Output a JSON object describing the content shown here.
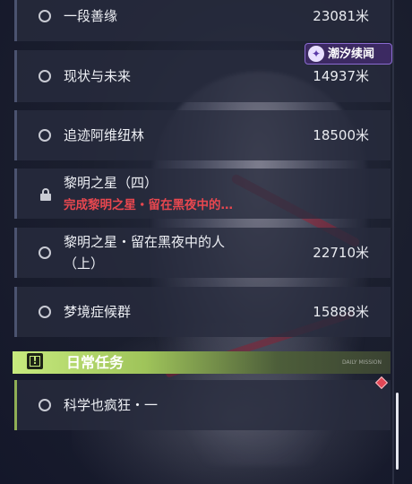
{
  "quests": [
    {
      "title": "一段善缘",
      "distance": "23081米"
    },
    {
      "title": "现状与未来",
      "distance": "14937米"
    },
    {
      "title": "追迹阿维纽林",
      "distance": "18500米"
    },
    {
      "title": "黎明之星（四）",
      "subtitle": "完成黎明之星・留在黑夜中的…",
      "locked": true
    },
    {
      "title_line1": "黎明之星・留在黑夜中的人",
      "title_line2": "（上）",
      "distance": "22710米"
    },
    {
      "title": "梦境症候群",
      "distance": "15888米"
    }
  ],
  "brand_badge": {
    "text": "潮汐续闻",
    "icon": "tide-logo-icon"
  },
  "daily_section": {
    "title": "日常任务",
    "icon": "exclamation-icon",
    "tag": "DAILY MISSION"
  },
  "daily_quests": [
    {
      "title": "科学也疯狂・一"
    }
  ],
  "colors": {
    "accent_green": "#c7ea7e",
    "alert_red": "#e8474f",
    "badge_purple": "#3c2a62"
  }
}
